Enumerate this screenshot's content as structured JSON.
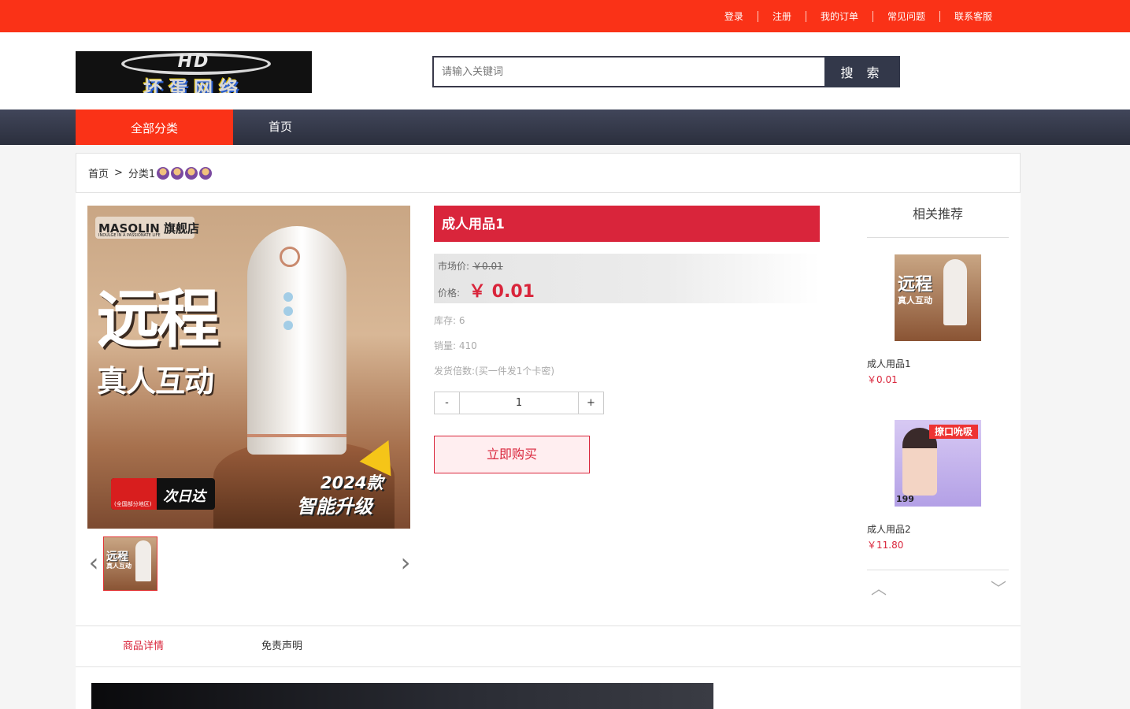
{
  "topbar": {
    "links": [
      {
        "label": "登录"
      },
      {
        "label": "注册"
      },
      {
        "label": "我的订单"
      },
      {
        "label": "常见问题"
      },
      {
        "label": "联系客服"
      }
    ]
  },
  "header": {
    "logo_text": "坏蛋网络",
    "logo_emblem": "HD",
    "search_placeholder": "请输入关键词",
    "search_button": "搜 索"
  },
  "nav": {
    "all_categories": "全部分类",
    "home": "首页"
  },
  "breadcrumb": {
    "home": "首页",
    "separator": ">",
    "category": "分类1"
  },
  "product": {
    "title": "成人用品1",
    "market_price_label": "市场价:",
    "market_price": "￥0.01",
    "price_label": "价格:",
    "price": "￥ 0.01",
    "stock": "库存: 6",
    "sales": "销量: 410",
    "delivery": "发货倍数:(买一件发1个卡密)",
    "qty_minus": "-",
    "qty_value": "1",
    "qty_plus": "+",
    "buy_button": "立即购买",
    "image": {
      "store": "MASOLIN 旗舰店",
      "store_sub": "INDULGE IN A PASSIONATE LIFE",
      "headline": "远程",
      "subline": "真人互动",
      "delivery_badge": "次日达",
      "delivery_note": "(全国部分地区)",
      "upgrade_year": "2024款",
      "upgrade_text": "智能升级"
    },
    "thumb": {
      "headline": "远程",
      "subline": "真人互动"
    }
  },
  "recommend": {
    "title": "相关推荐",
    "items": [
      {
        "name": "成人用品1",
        "price": "￥0.01",
        "img_headline": "远程",
        "img_subline": "真人互动"
      },
      {
        "name": "成人用品2",
        "price": "￥11.80",
        "img_badge": "撩口吮吸",
        "img_price": "199"
      }
    ]
  },
  "tabs": {
    "details": "商品详情",
    "disclaimer": "免责声明"
  },
  "icons": {
    "prev": "chevron-left-icon",
    "next": "chevron-right-icon",
    "up": "chevron-up-icon",
    "down": "chevron-down-icon"
  },
  "colors": {
    "brand_red": "#fa3217",
    "price_red": "#d9253b",
    "nav_dark": "#33384a"
  }
}
